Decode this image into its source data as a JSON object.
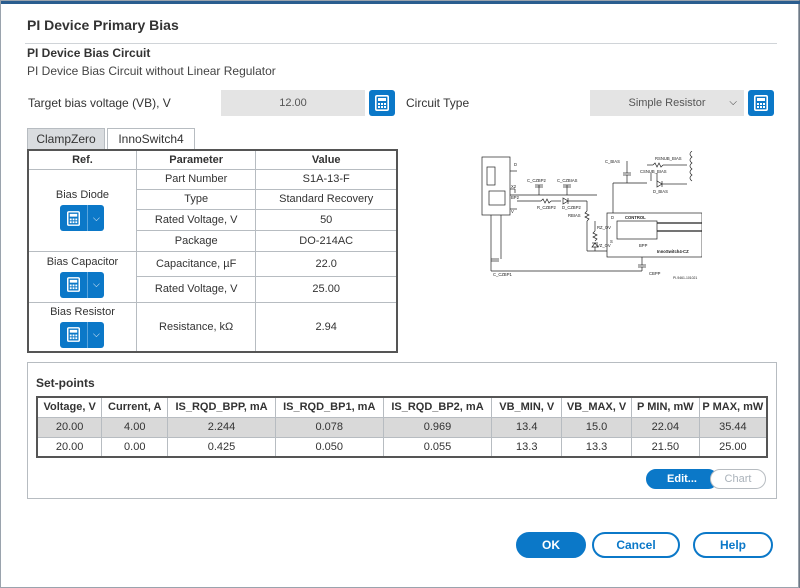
{
  "window": {
    "title": "PI Device Primary Bias"
  },
  "section": {
    "heading": "PI Device Bias Circuit",
    "subheading": "PI Device Bias Circuit without Linear Regulator"
  },
  "target": {
    "label": "Target bias voltage (VB), V",
    "value": "12.00"
  },
  "circuit": {
    "label": "Circuit Type",
    "selected": "Simple Resistor"
  },
  "tabs": [
    {
      "label": "ClampZero",
      "active": false
    },
    {
      "label": "InnoSwitch4",
      "active": true
    }
  ],
  "params_table": {
    "headers": [
      "Ref.",
      "Parameter",
      "Value"
    ],
    "groups": {
      "diode": {
        "ref": "Bias Diode",
        "rows": [
          {
            "param": "Part Number",
            "value": "S1A-13-F"
          },
          {
            "param": "Type",
            "value": "Standard Recovery"
          },
          {
            "param": "Rated Voltage, V",
            "value": "50"
          },
          {
            "param": "Package",
            "value": "DO-214AC"
          }
        ]
      },
      "capacitor": {
        "ref": "Bias Capacitor",
        "rows": [
          {
            "param": "Capacitance, µF",
            "value": "22.0"
          },
          {
            "param": "Rated Voltage, V",
            "value": "25.00"
          }
        ]
      },
      "resistor": {
        "ref": "Bias Resistor",
        "rows": [
          {
            "param": "Resistance, kΩ",
            "value": "2.94"
          }
        ]
      }
    }
  },
  "schematic": {
    "labels": {
      "c_bias": "C_BIAS",
      "rsnub": "RSNUB_BIAS",
      "csnub": "CSNUB_BIAS",
      "d_bias": "D_BIAS",
      "c_czbp2": "C_CZBP2",
      "c_czbias": "C_CZBIAS",
      "r_czbp2": "R_CZBP2",
      "d_czbp2": "D_CZBP2",
      "rbias": "RBIAS",
      "rz_ov": "RZ_OV",
      "vz_ov": "VZ_OV",
      "control": "CONTROL",
      "cbpp": "CBPP",
      "c_czbp1": "C_CZBP1",
      "inno": "InnoSwitch4-CZ",
      "bp2": "BP2",
      "x2": "X2",
      "vs": "V",
      "s": "S",
      "bpp": "BPP",
      "d": "D",
      "ref": "PI-9461-101021"
    }
  },
  "setpoints": {
    "title": "Set-points",
    "headers": [
      "Voltage, V",
      "Current, A",
      "IS_RQD_BPP, mA",
      "IS_RQD_BP1, mA",
      "IS_RQD_BP2, mA",
      "VB_MIN, V",
      "VB_MAX, V",
      "P MIN, mW",
      "P MAX, mW"
    ],
    "rows": [
      [
        "20.00",
        "4.00",
        "2.244",
        "0.078",
        "0.969",
        "13.4",
        "15.0",
        "22.04",
        "35.44"
      ],
      [
        "20.00",
        "0.00",
        "0.425",
        "0.050",
        "0.055",
        "13.3",
        "13.3",
        "21.50",
        "25.00"
      ]
    ],
    "edit_label": "Edit...",
    "chart_label": "Chart"
  },
  "footer": {
    "ok_label": "OK",
    "cancel_label": "Cancel",
    "help_label": "Help"
  },
  "colors": {
    "accent": "#0b78c8",
    "field_bg": "#e4e4e4",
    "selected_row": "#d9d9d9"
  }
}
